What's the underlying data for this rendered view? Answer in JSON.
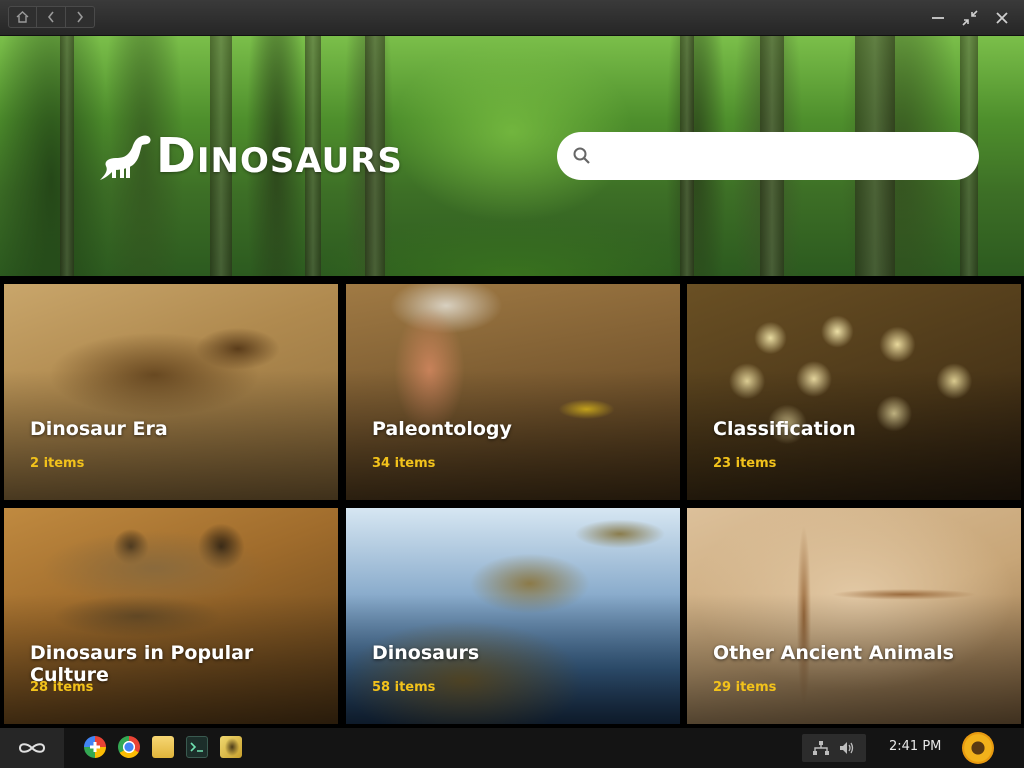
{
  "titlebar": {
    "nav": [
      {
        "icon": "home-icon"
      },
      {
        "icon": "back-icon"
      },
      {
        "icon": "forward-icon"
      }
    ],
    "controls": [
      {
        "icon": "minimize-icon"
      },
      {
        "icon": "restore-icon"
      },
      {
        "icon": "close-icon"
      }
    ]
  },
  "header": {
    "logo_text": "Dinosaurs",
    "search_placeholder": ""
  },
  "tiles": [
    {
      "title": "Dinosaur Era",
      "count": "2 items"
    },
    {
      "title": "Paleontology",
      "count": "34 items"
    },
    {
      "title": "Classification",
      "count": "23 items"
    },
    {
      "title": "Dinosaurs in Popular Culture",
      "count": "28 items"
    },
    {
      "title": "Dinosaurs",
      "count": "58 items"
    },
    {
      "title": "Other Ancient Animals",
      "count": "29 items"
    }
  ],
  "taskbar": {
    "apps": [
      "app-store-icon",
      "chrome-icon",
      "files-icon",
      "terminal-icon",
      "dinosaurs-app-icon"
    ],
    "tray": [
      "network-icon",
      "volume-icon"
    ],
    "clock": "2:41 PM"
  },
  "colors": {
    "accent_count": "#f2c21b",
    "titlebar": "#2a2a2a",
    "taskbar": "#141414"
  }
}
